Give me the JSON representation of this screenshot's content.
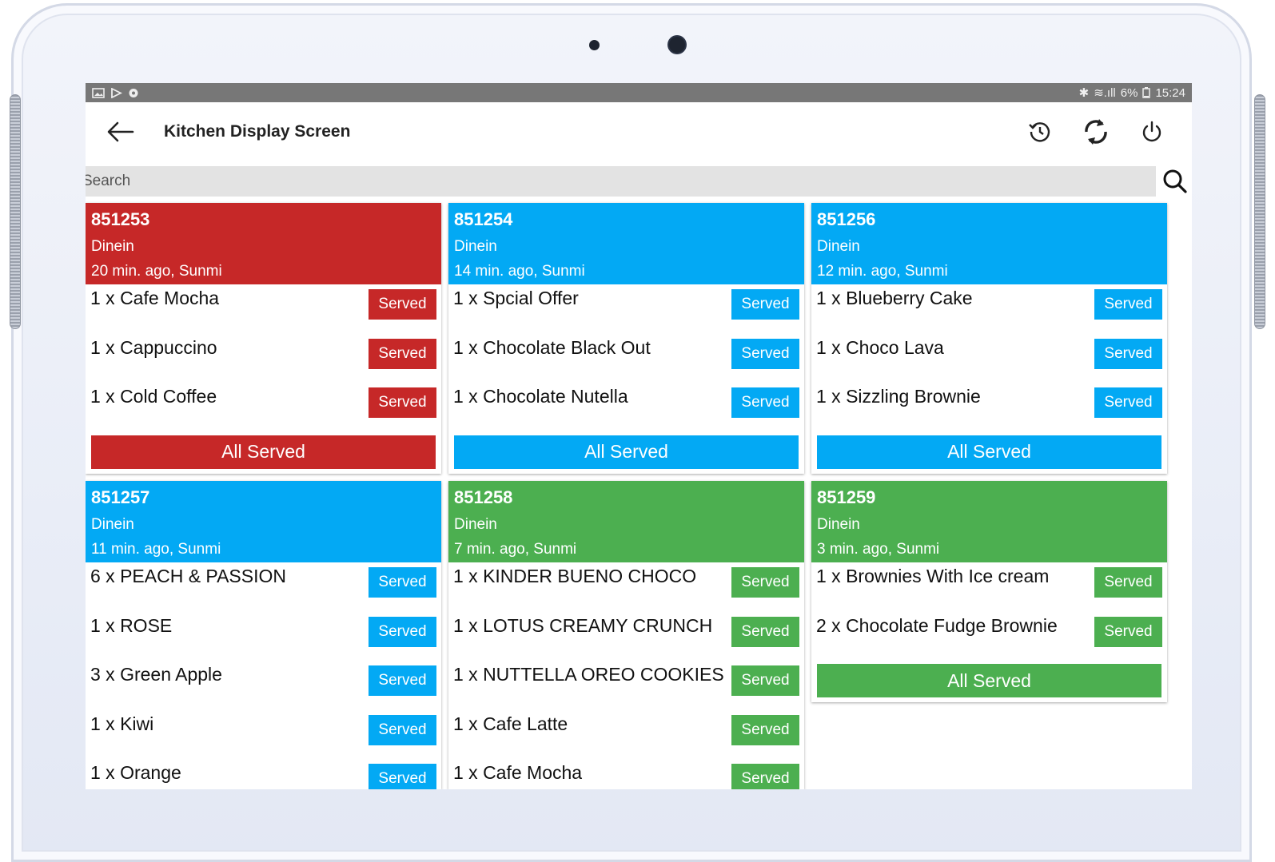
{
  "colors": {
    "red": "#c62828",
    "blue": "#03a9f4",
    "green": "#4caf50",
    "statusbar": "#777777"
  },
  "status": {
    "battery": "6%",
    "time": "15:24"
  },
  "appbar": {
    "title": "Kitchen Display Screen",
    "icons": [
      "back-arrow-icon",
      "history-icon",
      "sync-icon",
      "power-icon"
    ]
  },
  "search": {
    "placeholder": "Search"
  },
  "orders": [
    {
      "id": "851253",
      "type": "Dinein",
      "meta": "20 min. ago, Sunmi",
      "color": "red",
      "items": [
        {
          "name": "1 x Cafe Mocha",
          "action": "Served"
        },
        {
          "name": "1 x Cappuccino",
          "action": "Served"
        },
        {
          "name": "1 x Cold Coffee",
          "action": "Served"
        }
      ],
      "all_served": "All Served"
    },
    {
      "id": "851254",
      "type": "Dinein",
      "meta": "14 min. ago, Sunmi",
      "color": "blue",
      "items": [
        {
          "name": "1 x Spcial Offer",
          "action": "Served"
        },
        {
          "name": "1 x Chocolate Black Out",
          "action": "Served"
        },
        {
          "name": "1 x Chocolate Nutella",
          "action": "Served"
        }
      ],
      "all_served": "All Served"
    },
    {
      "id": "851256",
      "type": "Dinein",
      "meta": "12 min. ago, Sunmi",
      "color": "blue",
      "items": [
        {
          "name": "1 x Blueberry Cake",
          "action": "Served"
        },
        {
          "name": "1 x Choco Lava",
          "action": "Served"
        },
        {
          "name": "1 x Sizzling Brownie",
          "action": "Served"
        }
      ],
      "all_served": "All Served"
    },
    {
      "id": "851257",
      "type": "Dinein",
      "meta": "11 min. ago, Sunmi",
      "color": "blue",
      "items": [
        {
          "name": "6 x PEACH & PASSION",
          "action": "Served"
        },
        {
          "name": "1 x ROSE",
          "action": "Served"
        },
        {
          "name": "3 x Green Apple",
          "action": "Served"
        },
        {
          "name": "1 x Kiwi",
          "action": "Served"
        },
        {
          "name": "1 x Orange",
          "action": "Served"
        }
      ]
    },
    {
      "id": "851258",
      "type": "Dinein",
      "meta": "7 min. ago, Sunmi",
      "color": "green",
      "items": [
        {
          "name": "1 x KINDER BUENO CHOCO",
          "action": "Served"
        },
        {
          "name": "1 x LOTUS CREAMY CRUNCH",
          "action": "Served"
        },
        {
          "name": "1 x NUTTELLA OREO COOKIES",
          "action": "Served"
        },
        {
          "name": "1 x Cafe Latte",
          "action": "Served"
        },
        {
          "name": "1 x Cafe Mocha",
          "action": "Served"
        }
      ]
    },
    {
      "id": "851259",
      "type": "Dinein",
      "meta": "3 min. ago, Sunmi",
      "color": "green",
      "items": [
        {
          "name": "1 x Brownies With Ice cream",
          "action": "Served"
        },
        {
          "name": "2 x Chocolate Fudge Brownie",
          "action": "Served"
        }
      ],
      "all_served": "All Served"
    }
  ]
}
